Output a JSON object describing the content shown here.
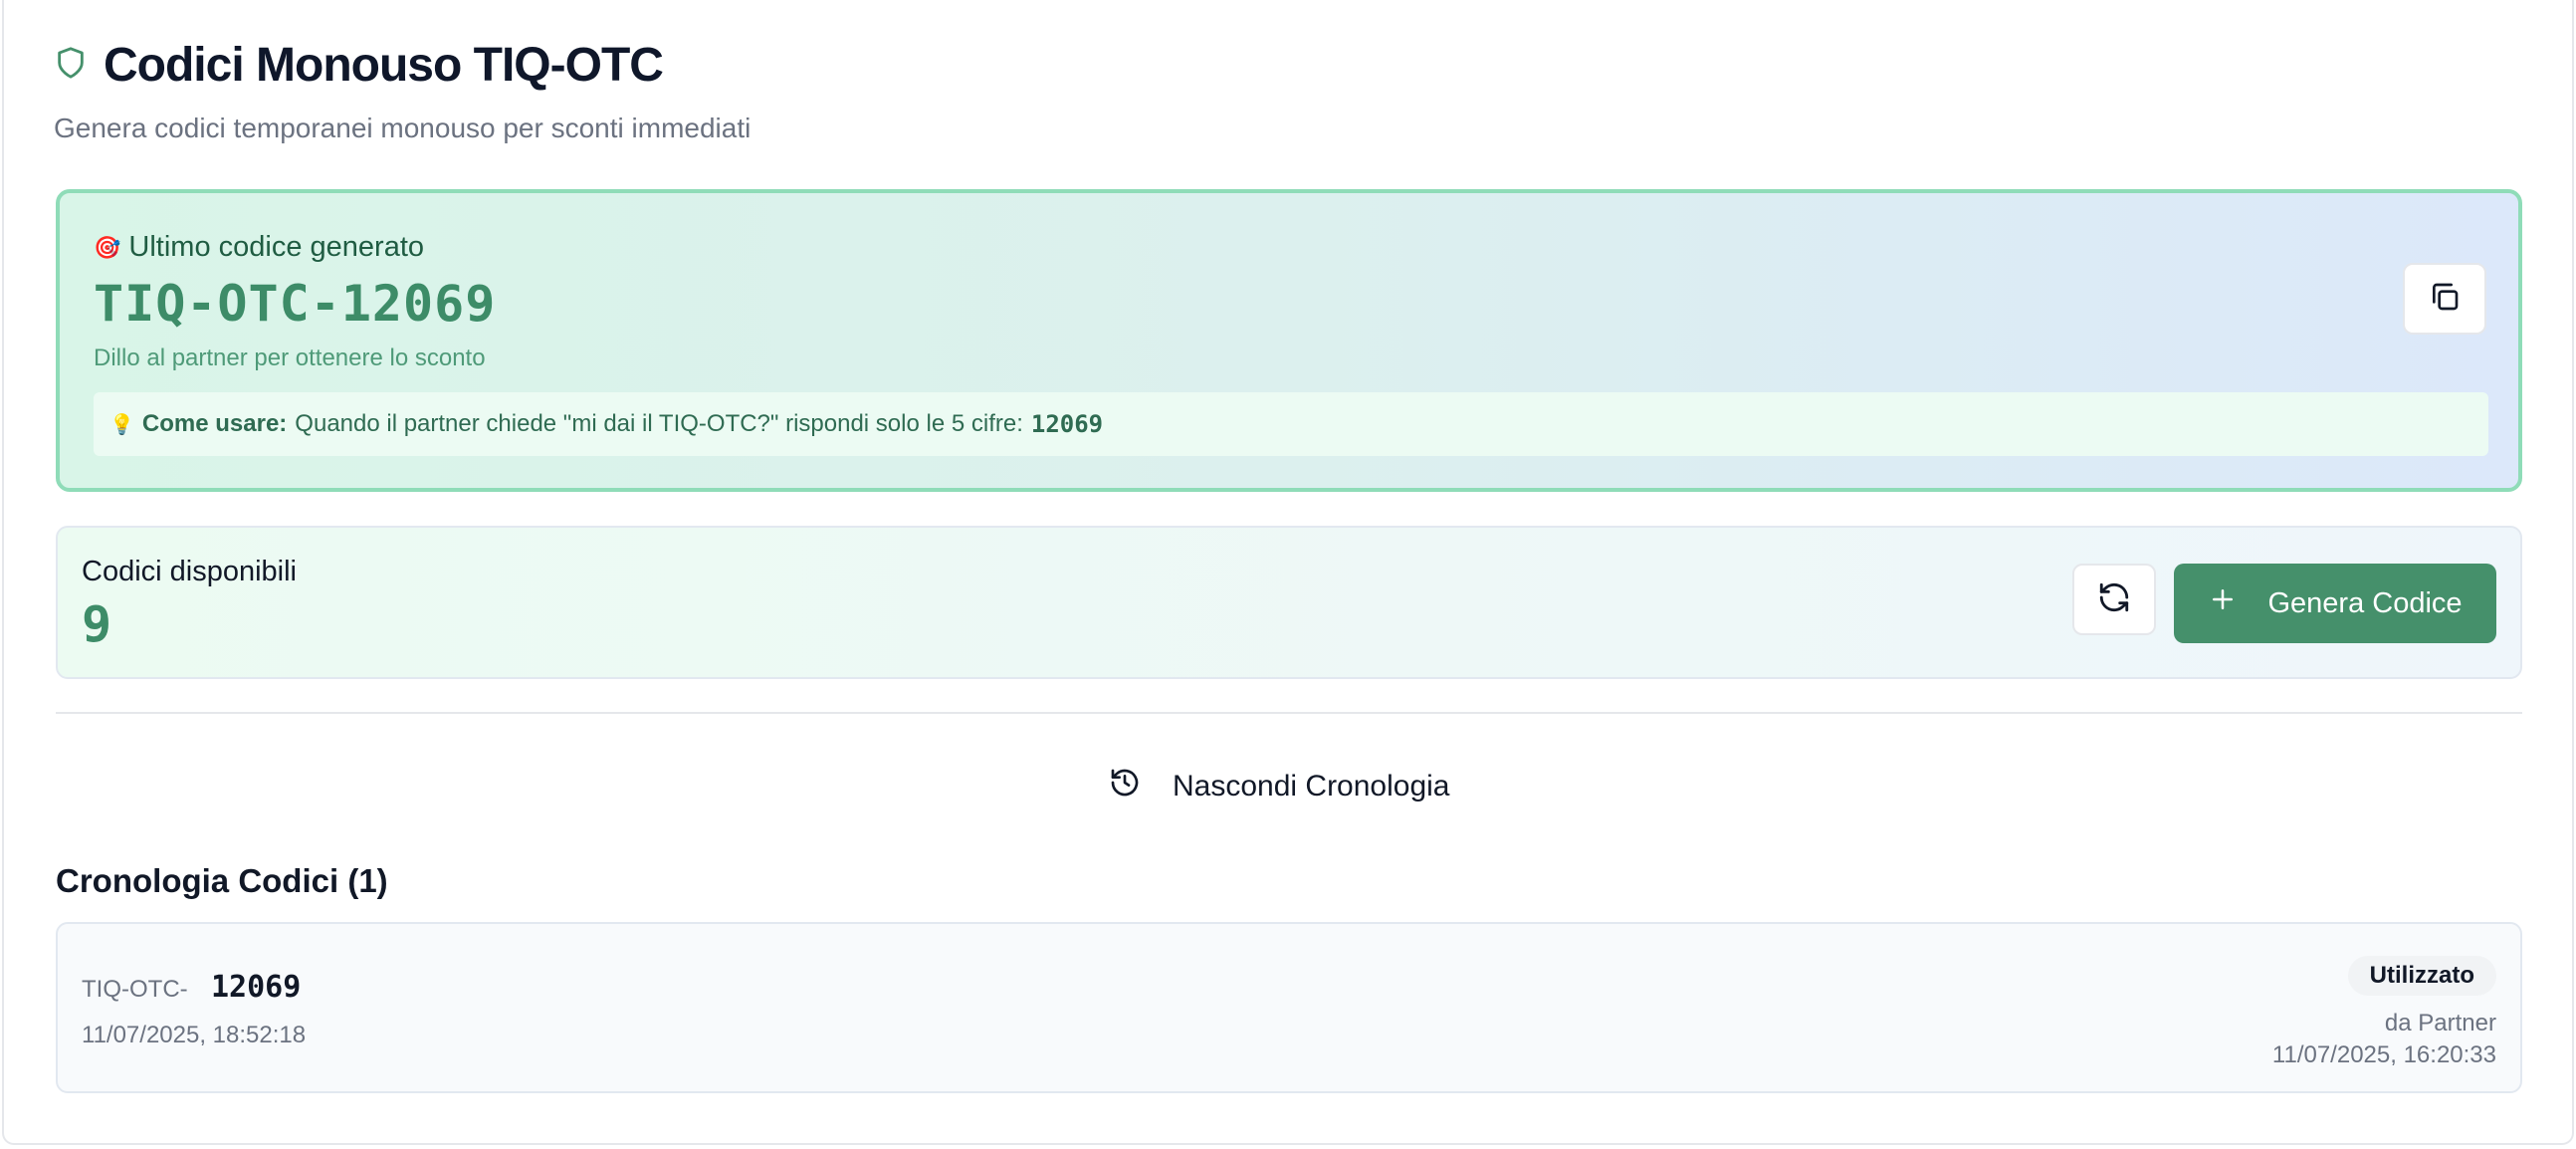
{
  "header": {
    "title": "Codici Monouso TIQ-OTC",
    "subtitle": "Genera codici temporanei monouso per sconti immediati",
    "icon": "shield-icon"
  },
  "last_code": {
    "label_emoji": "🎯",
    "label": "Ultimo codice generato",
    "code": "TIQ-OTC-12069",
    "hint": "Dillo al partner per ottenere lo sconto",
    "howto_emoji": "💡",
    "howto_bold": "Come usare:",
    "howto_text": "Quando il partner chiede \"mi dai il TIQ-OTC?\" rispondi solo le 5 cifre:",
    "howto_digits": "12069",
    "copy_icon": "copy-icon"
  },
  "available": {
    "label": "Codici disponibili",
    "count": "9",
    "refresh_icon": "refresh-icon",
    "generate_label": "Genera Codice"
  },
  "history_toggle": {
    "label": "Nascondi Cronologia",
    "icon": "history-icon"
  },
  "history": {
    "title": "Cronologia Codici (1)",
    "items": [
      {
        "prefix": "TIQ-OTC-",
        "code": "12069",
        "created": "11/07/2025, 18:52:18",
        "status": "Utilizzato",
        "used_by": "da Partner",
        "used_at": "11/07/2025, 16:20:33"
      }
    ]
  },
  "colors": {
    "accent": "#45906b",
    "code_green": "#3d8c68",
    "border_green": "#8fdcb8"
  }
}
